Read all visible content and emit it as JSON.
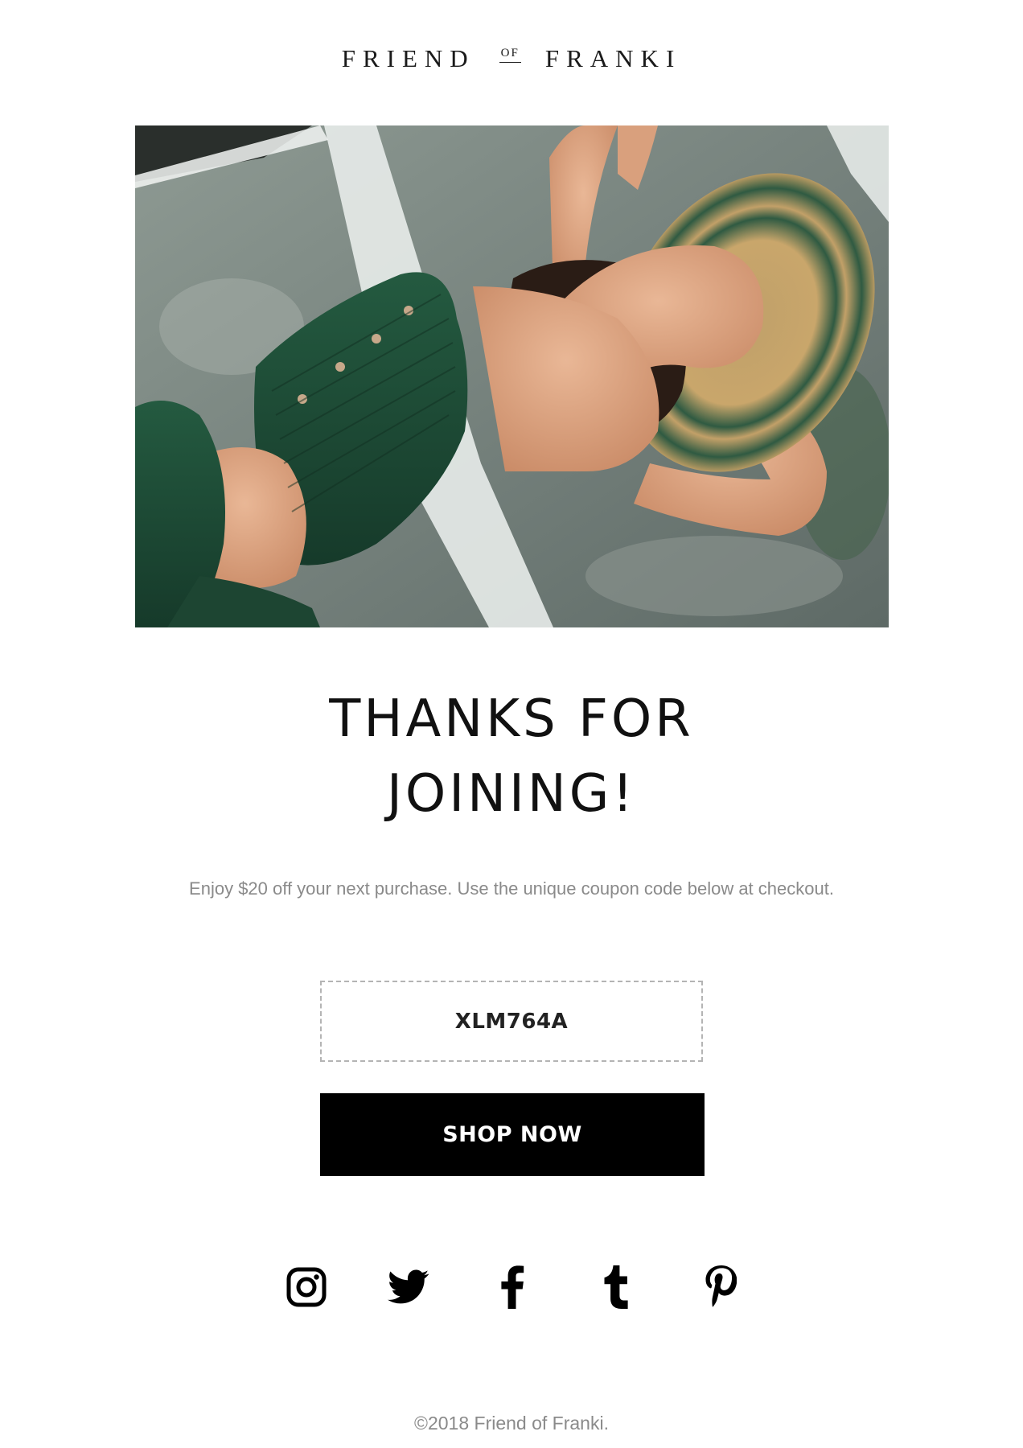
{
  "brand": {
    "logo_left": "FRIEND",
    "logo_of": "OF",
    "logo_right": "FRANKI"
  },
  "hero": {
    "image_alt": "Woman in green smocked two-piece lying on stone wearing a straw hat"
  },
  "main": {
    "headline_line1": "THANKS FOR",
    "headline_line2": "JOINING!",
    "subtext": "Enjoy $20 off your next purchase. Use the unique coupon code below at checkout.",
    "coupon_code": "XLM764A",
    "cta_label": "SHOP NOW"
  },
  "social": [
    {
      "name": "instagram",
      "icon": "instagram-icon"
    },
    {
      "name": "twitter",
      "icon": "twitter-icon"
    },
    {
      "name": "facebook",
      "icon": "facebook-icon"
    },
    {
      "name": "tumblr",
      "icon": "tumblr-icon"
    },
    {
      "name": "pinterest",
      "icon": "pinterest-icon"
    }
  ],
  "footer": {
    "copyright": "©2018 Friend of Franki."
  },
  "colors": {
    "background": "#ffffff",
    "text": "#111111",
    "muted": "#8a8a8a",
    "button": "#000000",
    "coupon_border": "#b4b4b4",
    "garment_green": "#1f4a36",
    "hat_straw": "#c9a66b"
  }
}
